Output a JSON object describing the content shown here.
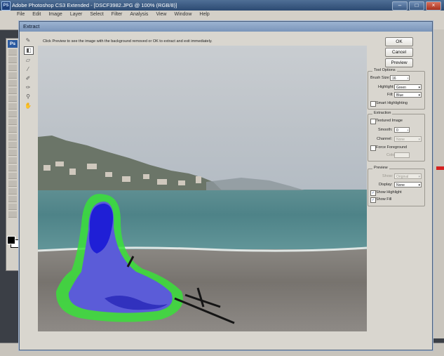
{
  "app": {
    "title": "Adobe Photoshop CS3 Extended - [DSCF3982.JPG @ 100% (RGB/8)]",
    "logo": "PS",
    "toolbox_badge": "Ps",
    "menu": [
      "File",
      "Edit",
      "Image",
      "Layer",
      "Select",
      "Filter",
      "Analysis",
      "View",
      "Window",
      "Help"
    ]
  },
  "dialog": {
    "title": "Extract",
    "hint": "Click Preview to see the image with the background removed or OK to extract and exit immediately.",
    "tools": [
      "edge-highlighter-icon",
      "fill-bucket-icon",
      "eraser-icon",
      "eyedropper-icon",
      "cleanup-icon",
      "edge-touchup-icon",
      "zoom-icon",
      "hand-icon"
    ]
  },
  "buttons": {
    "ok": "OK",
    "cancel": "Cancel",
    "preview": "Preview"
  },
  "tool_options": {
    "title": "Tool Options",
    "brush_size_label": "Brush Size:",
    "brush_size_value": "16",
    "highlight_label": "Highlight:",
    "highlight_value": "Green",
    "fill_label": "Fill:",
    "fill_value": "Blue",
    "smart_highlighting_label": "Smart Highlighting",
    "smart_highlighting_checked": false
  },
  "extraction": {
    "title": "Extraction",
    "textured_image_label": "Textured Image",
    "textured_image_checked": false,
    "smooth_label": "Smooth:",
    "smooth_value": "0",
    "channel_label": "Channel:",
    "channel_value": "None",
    "force_foreground_label": "Force Foreground",
    "force_foreground_checked": false,
    "color_label": "Color:"
  },
  "preview": {
    "title": "Preview",
    "show_label": "Show:",
    "show_value": "Original",
    "display_label": "Display:",
    "display_value": "None",
    "show_highlight_label": "Show Highlight",
    "show_highlight_checked": true,
    "show_fill_label": "Show Fill",
    "show_fill_checked": true
  },
  "colors": {
    "highlight": "#39e03a",
    "fill": "#1f1fd6",
    "dialog_bg": "#d9d6cf"
  }
}
